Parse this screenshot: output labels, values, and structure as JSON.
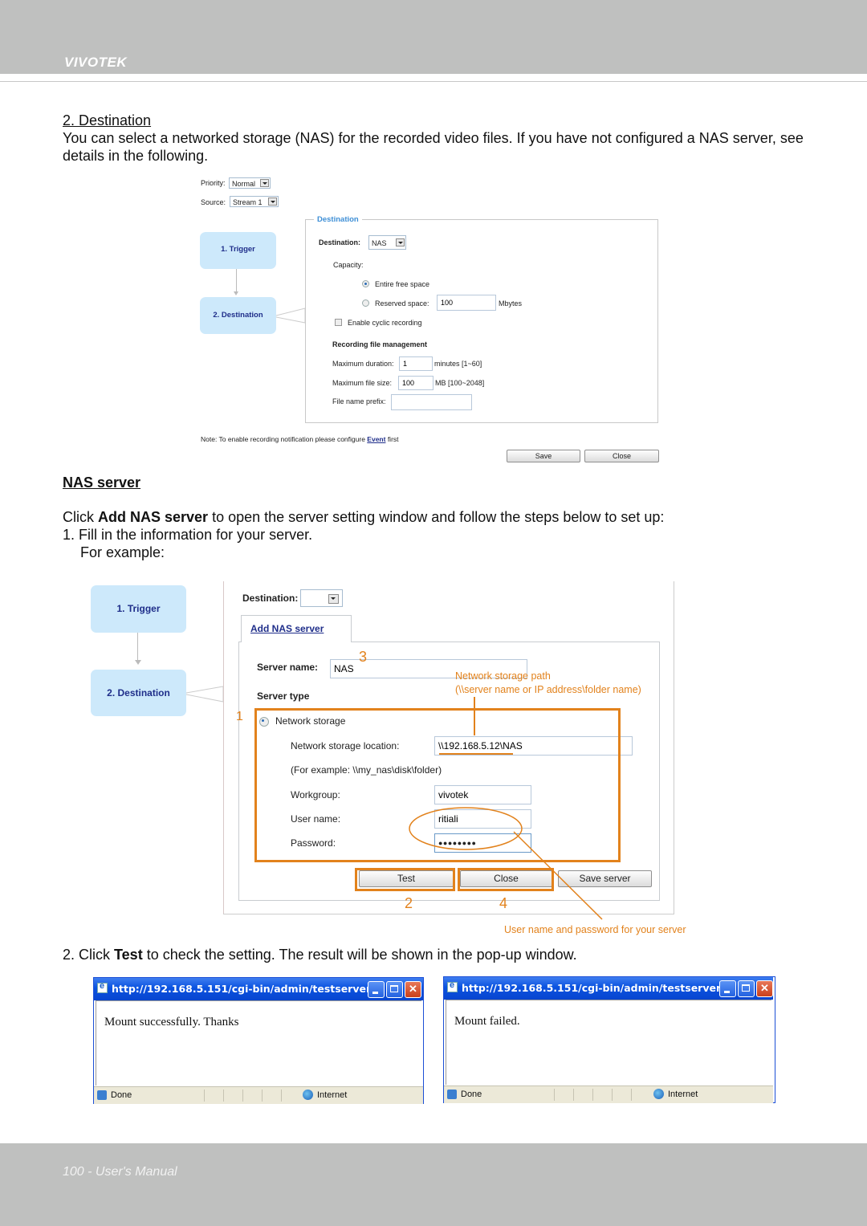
{
  "header": {
    "brand": "VIVOTEK"
  },
  "section_destination": {
    "heading": "2. Destination",
    "paragraph": "You can select a networked storage (NAS) for the recorded video files. If you have not configured a NAS server, see details in the following."
  },
  "screenshot1": {
    "priority_label": "Priority:",
    "priority_value": "Normal",
    "source_label": "Source:",
    "source_value": "Stream 1",
    "steps": [
      "1. Trigger",
      "2. Destination"
    ],
    "legend": "Destination",
    "destination_label": "Destination:",
    "destination_value": "NAS",
    "capacity_label": "Capacity:",
    "radio_entire": "Entire free space",
    "radio_reserved": "Reserved space:",
    "reserved_value": "100",
    "reserved_unit": "Mbytes",
    "cyclic_label": "Enable cyclic recording",
    "rfm_heading": "Recording file management",
    "max_duration_label": "Maximum duration:",
    "max_duration_value": "1",
    "max_duration_unit": "minutes [1~60]",
    "max_size_label": "Maximum file size:",
    "max_size_value": "100",
    "max_size_unit": "MB [100~2048]",
    "prefix_label": "File name prefix:",
    "prefix_value": "",
    "note_prefix": "Note: To enable recording notification please configure ",
    "note_link": "Event",
    "note_suffix": " first",
    "save_button": "Save",
    "close_button": "Close"
  },
  "section_nas": {
    "heading": "NAS server",
    "intro_prefix": "Click ",
    "intro_bold": "Add NAS server",
    "intro_suffix": " to open the server setting window and follow the steps below to set up:",
    "step1": "1. Fill in the information for your server.",
    "step1_example": "For example:"
  },
  "screenshot2": {
    "steps": [
      "1. Trigger",
      "2. Destination"
    ],
    "destination_label": "Destination:",
    "destination_value": "",
    "tab_label": "Add NAS server",
    "server_name_label": "Server name:",
    "server_name_value": "NAS",
    "server_type_label": "Server type",
    "radio_network_storage": "Network storage",
    "location_label": "Network storage location:",
    "location_value": "\\\\192.168.5.12\\NAS",
    "example_text": "(For example: \\\\my_nas\\disk\\folder)",
    "workgroup_label": "Workgroup:",
    "workgroup_value": "vivotek",
    "username_label": "User name:",
    "username_value": "ritiali",
    "password_label": "Password:",
    "password_value": "●●●●●●●●",
    "test_button": "Test",
    "close_button": "Close",
    "save_server_button": "Save server",
    "annotations": {
      "n1": "1",
      "n2": "2",
      "n3": "3",
      "n4": "4",
      "path_title": "Network storage path",
      "path_format": "(\\\\server name or IP address\\folder name)",
      "credentials_note": "User name and password for your server"
    },
    "accent_color": "#e2821c"
  },
  "step2": {
    "prefix": "2. Click ",
    "bold": "Test",
    "suffix": " to check the setting. The result will be shown in the pop-up window."
  },
  "popups": [
    {
      "title": "http://192.168.5.151/cgi-bin/admin/testserver...",
      "message": "Mount successfully. Thanks",
      "status_left": "Done",
      "status_zone": "Internet"
    },
    {
      "title": "http://192.168.5.151/cgi-bin/admin/testserver...",
      "message": "Mount failed.",
      "status_left": "Done",
      "status_zone": "Internet"
    }
  ],
  "footer": {
    "page": "100 - User's Manual"
  }
}
